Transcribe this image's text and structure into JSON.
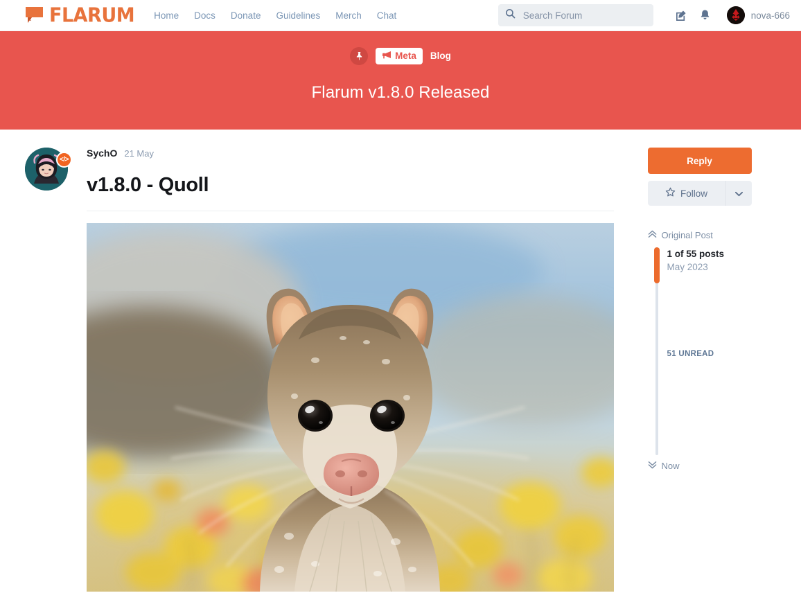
{
  "header": {
    "logo_text": "FLARUM",
    "logo_icon": "speech-bubble-icon",
    "nav": [
      {
        "label": "Home"
      },
      {
        "label": "Docs"
      },
      {
        "label": "Donate"
      },
      {
        "label": "Guidelines"
      },
      {
        "label": "Merch"
      },
      {
        "label": "Chat"
      }
    ],
    "search": {
      "placeholder": "Search Forum",
      "value": "",
      "icon": "search-icon"
    },
    "compose_icon": "compose-pencil-icon",
    "notifications_icon": "bell-icon",
    "user": {
      "name": "nova-666",
      "avatar": "user-avatar"
    }
  },
  "hero": {
    "pin_icon": "pin-icon",
    "tag": {
      "label": "Meta",
      "icon": "megaphone-icon"
    },
    "secondary_tag": "Blog",
    "title": "Flarum v1.8.0 Released",
    "background_color": "#e8554e"
  },
  "post": {
    "author": "SychO",
    "date": "21 May",
    "badge_label": "</>",
    "title": "v1.8.0 - Quoll",
    "image_alt": "quoll-photo"
  },
  "sidebar": {
    "reply_label": "Reply",
    "follow_label": "Follow",
    "follow_icon": "star-icon",
    "caret_icon": "chevron-down-icon",
    "scrubber": {
      "top_label": "Original Post",
      "top_icon": "chevron-double-up-icon",
      "count_label": "1 of 55 posts",
      "date_label": "May 2023",
      "unread_label": "51 UNREAD",
      "bottom_label": "Now",
      "bottom_icon": "chevron-double-down-icon"
    }
  },
  "colors": {
    "brand_orange": "#ed6c30",
    "hero_red": "#e8554e",
    "muted_blue": "#7b96b5"
  }
}
